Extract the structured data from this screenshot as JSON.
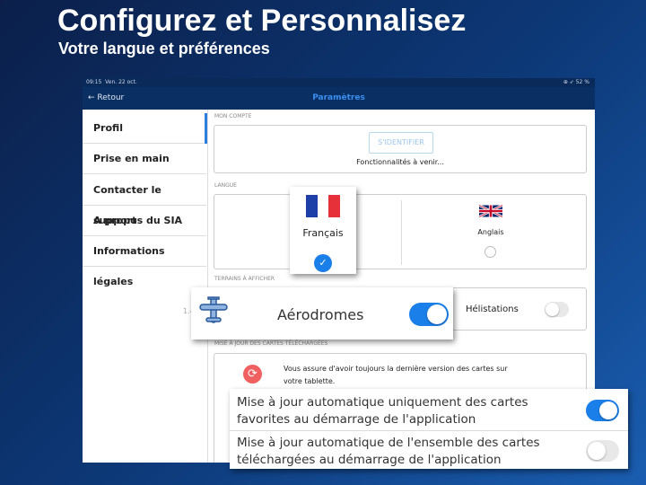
{
  "headline": {
    "title": "Configurez et Personnalisez",
    "subtitle": "Votre langue et préférences"
  },
  "status_bar": {
    "time": "09:15",
    "date": "Ven. 22 oct.",
    "right": "⊕ ➶ 52 %"
  },
  "nav": {
    "back": "Retour",
    "title": "Paramètres"
  },
  "sidebar": {
    "items": [
      {
        "label": "Profil"
      },
      {
        "label": "Prise en main"
      },
      {
        "label": "Contacter le support"
      },
      {
        "label": "A propos du SIA"
      },
      {
        "label": "Informations légales"
      }
    ],
    "version": "1.4.0"
  },
  "account": {
    "heading": "MON COMPTE",
    "login": "S'IDENTIFIER",
    "note": "Fonctionnalités à venir..."
  },
  "language": {
    "heading": "LANGUE",
    "french": "Français",
    "english": "Anglais",
    "selected": "Français"
  },
  "terrains": {
    "heading": "TERRAINS À AFFICHER",
    "aerodromes": "Aérodromes",
    "aerodromes_on": true,
    "helistations": "Hélistations",
    "helistations_on": false
  },
  "updates": {
    "heading": "MISE À JOUR DES CARTES TÉLÉCHARGÉES",
    "desc1": "Vous assure d'avoir toujours la dernière version des cartes sur",
    "desc2": "votre tablette.",
    "opt1_l1": "Mise à jour automatique uniquement des cartes",
    "opt1_l2": "favorites au démarrage de l'application",
    "opt1_on": true,
    "opt2_l1": "Mise à jour automatique de l'ensemble des cartes",
    "opt2_l2": "téléchargées au démarrage de l'application",
    "opt2_on": false
  },
  "colors": {
    "accent": "#1a7fe8",
    "nav": "#0a2f63",
    "sync": "#f06060"
  }
}
